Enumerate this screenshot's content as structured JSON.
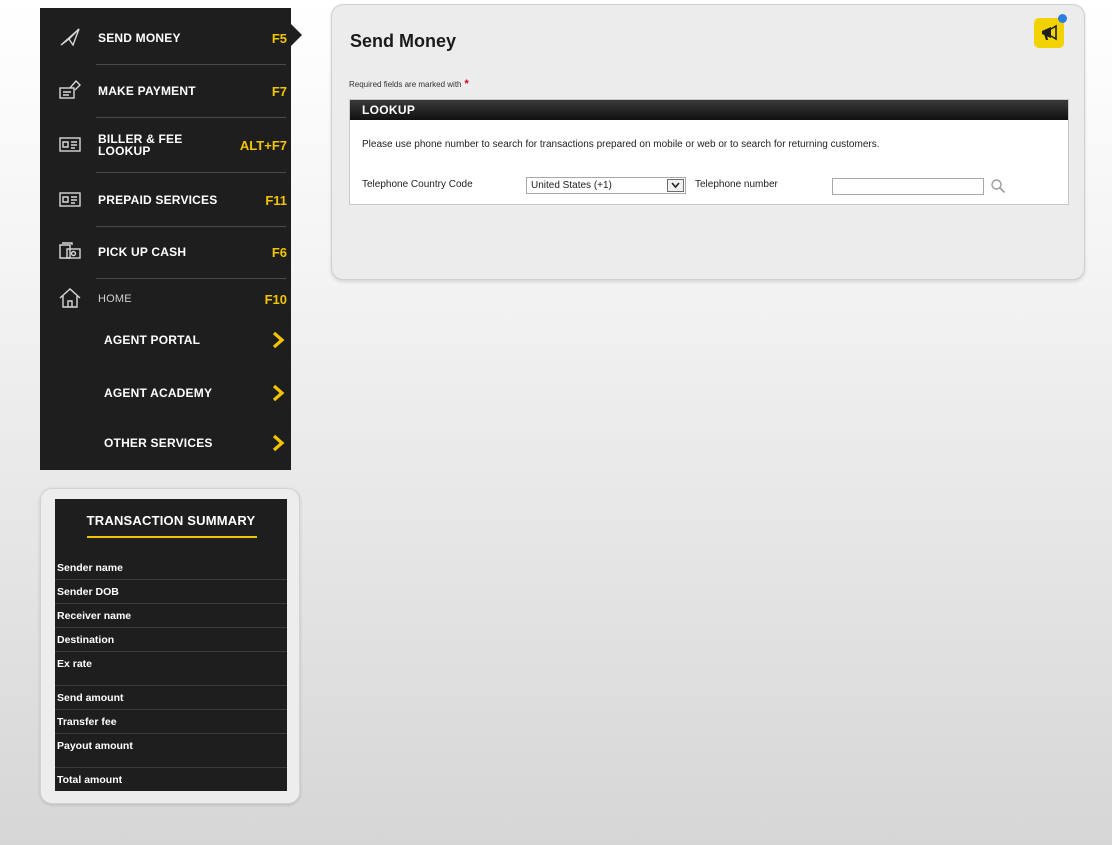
{
  "sidebar": {
    "items": [
      {
        "label": "SEND MONEY",
        "key": "F5",
        "icon": "send-icon"
      },
      {
        "label": "MAKE PAYMENT",
        "key": "F7",
        "icon": "payment-icon"
      },
      {
        "label": "BILLER & FEE LOOKUP",
        "key": "ALT+F7",
        "icon": "card-icon"
      },
      {
        "label": "PREPAID SERVICES",
        "key": "F11",
        "icon": "card-icon"
      },
      {
        "label": "PICK UP CASH",
        "key": "F6",
        "icon": "cash-icon"
      },
      {
        "label": "HOME",
        "key": "F10",
        "icon": "home-icon"
      }
    ],
    "sub_items": [
      {
        "label": "AGENT PORTAL"
      },
      {
        "label": "AGENT ACADEMY"
      },
      {
        "label": "OTHER SERVICES"
      }
    ]
  },
  "summary": {
    "title": "TRANSACTION SUMMARY",
    "rows": [
      "Sender name",
      "Sender DOB",
      "Receiver name",
      "Destination",
      "Ex rate",
      "Send amount",
      "Transfer fee",
      "Payout amount",
      "Total amount"
    ]
  },
  "main": {
    "title": "Send Money",
    "required_note": "Required fields are marked with",
    "required_marker": "*",
    "lookup": {
      "header": "LOOKUP",
      "description": "Please use phone number to search for transactions prepared on mobile or web or to search for returning customers.",
      "country_code_label": "Telephone Country Code",
      "country_code_value": "United States (+1)",
      "phone_label": "Telephone number",
      "phone_value": ""
    }
  },
  "colors": {
    "sidebar_bg": "#1e1e1e",
    "accent": "#f2c500",
    "required": "#d0021b",
    "notify_dot": "#2b7de0"
  }
}
